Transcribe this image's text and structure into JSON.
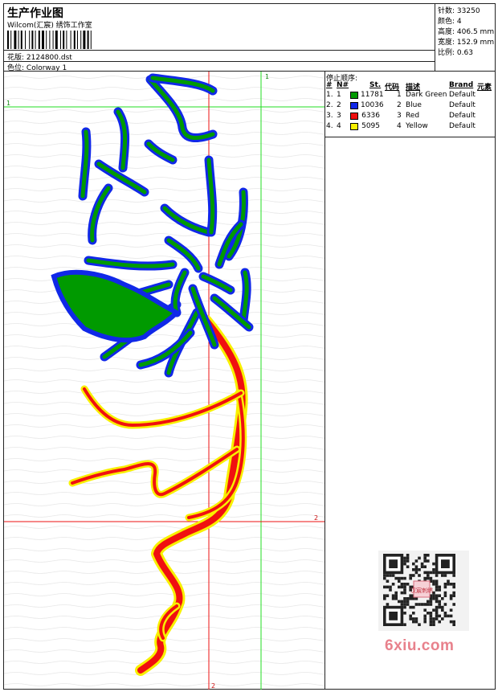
{
  "header": {
    "title": "生产作业图",
    "studio": "Wilcom(汇宸) 绣饰工作室",
    "design_file_label": "花版:",
    "design_file": "2124800.dst",
    "colorway_label": "色位:",
    "colorway": "Colorway 1"
  },
  "specs": [
    {
      "label": "针数:",
      "value": "33250"
    },
    {
      "label": "颜色:",
      "value": "4"
    },
    {
      "label": "高度:",
      "value": "406.5 mm"
    },
    {
      "label": "宽度:",
      "value": "152.9 mm"
    },
    {
      "label": "比例:",
      "value": "0.63"
    }
  ],
  "stop_sequence": {
    "title": "停止顺序:",
    "headers": {
      "idx": "#",
      "n": "N#",
      "st": "St.",
      "code": "代码",
      "desc": "描述",
      "brand": "Brand",
      "elem": "元素"
    },
    "rows": [
      {
        "idx": "1.",
        "n": "1",
        "color": "#009a00",
        "st": "11781",
        "code": "1",
        "desc": "Dark Green",
        "brand": "Default"
      },
      {
        "idx": "2.",
        "n": "2",
        "color": "#1028e8",
        "st": "10036",
        "code": "2",
        "desc": "Blue",
        "brand": "Default"
      },
      {
        "idx": "3.",
        "n": "3",
        "color": "#f01010",
        "st": "6336",
        "code": "3",
        "desc": "Red",
        "brand": "Default"
      },
      {
        "idx": "4.",
        "n": "4",
        "color": "#f8f000",
        "st": "5095",
        "code": "4",
        "desc": "Yellow",
        "brand": "Default"
      }
    ]
  },
  "guides": {
    "green_label": "1",
    "red_label": "2"
  },
  "qr_badge": "汉宸刺绣",
  "watermark": "6xiu.com"
}
